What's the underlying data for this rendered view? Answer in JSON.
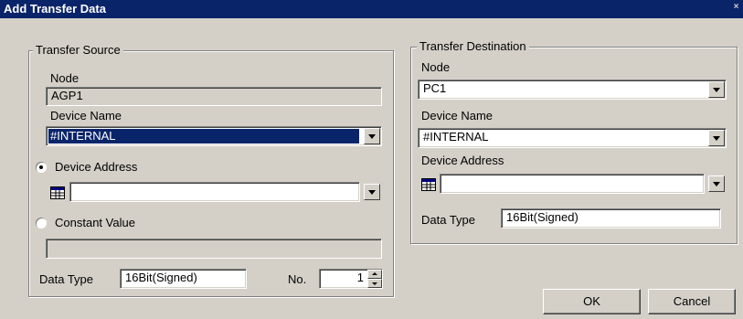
{
  "window": {
    "title": "Add Transfer Data",
    "close_glyph": "×"
  },
  "source": {
    "legend": "Transfer Source",
    "node_label": "Node",
    "node_value": "AGP1",
    "device_name_label": "Device Name",
    "device_name_value": "#INTERNAL",
    "device_address_radio_label": "Device Address",
    "device_address_value": "",
    "constant_value_radio_label": "Constant Value",
    "constant_value": "",
    "data_type_label": "Data Type",
    "data_type_value": "16Bit(Signed)",
    "no_label": "No.",
    "no_value": "1",
    "selected_radio": "device_address"
  },
  "destination": {
    "legend": "Transfer Destination",
    "node_label": "Node",
    "node_value": "PC1",
    "device_name_label": "Device Name",
    "device_name_value": "#INTERNAL",
    "device_address_label": "Device Address",
    "device_address_value": "",
    "data_type_label": "Data Type",
    "data_type_value": "16Bit(Signed)"
  },
  "buttons": {
    "ok": "OK",
    "cancel": "Cancel"
  },
  "icons": {
    "device_picker": "device-address-input-icon"
  }
}
